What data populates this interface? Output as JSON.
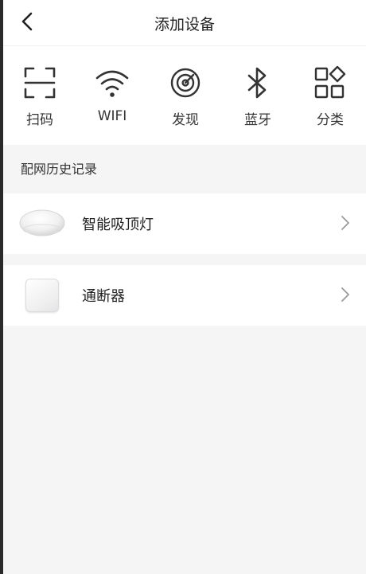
{
  "header": {
    "title": "添加设备",
    "back_icon": "chevron-left-icon"
  },
  "methods": [
    {
      "label": "扫码",
      "icon": "scan-icon"
    },
    {
      "label": "WIFI",
      "icon": "wifi-icon"
    },
    {
      "label": "发现",
      "icon": "radar-icon"
    },
    {
      "label": "蓝牙",
      "icon": "bluetooth-icon"
    },
    {
      "label": "分类",
      "icon": "category-icon"
    }
  ],
  "history": {
    "title": "配网历史记录",
    "devices": [
      {
        "name": "智能吸顶灯",
        "image": "ceiling-lamp-image"
      },
      {
        "name": "通断器",
        "image": "switch-module-image"
      }
    ]
  },
  "colors": {
    "background": "#f5f5f5",
    "card": "#ffffff",
    "icon": "#333333",
    "chevron": "#999999"
  }
}
